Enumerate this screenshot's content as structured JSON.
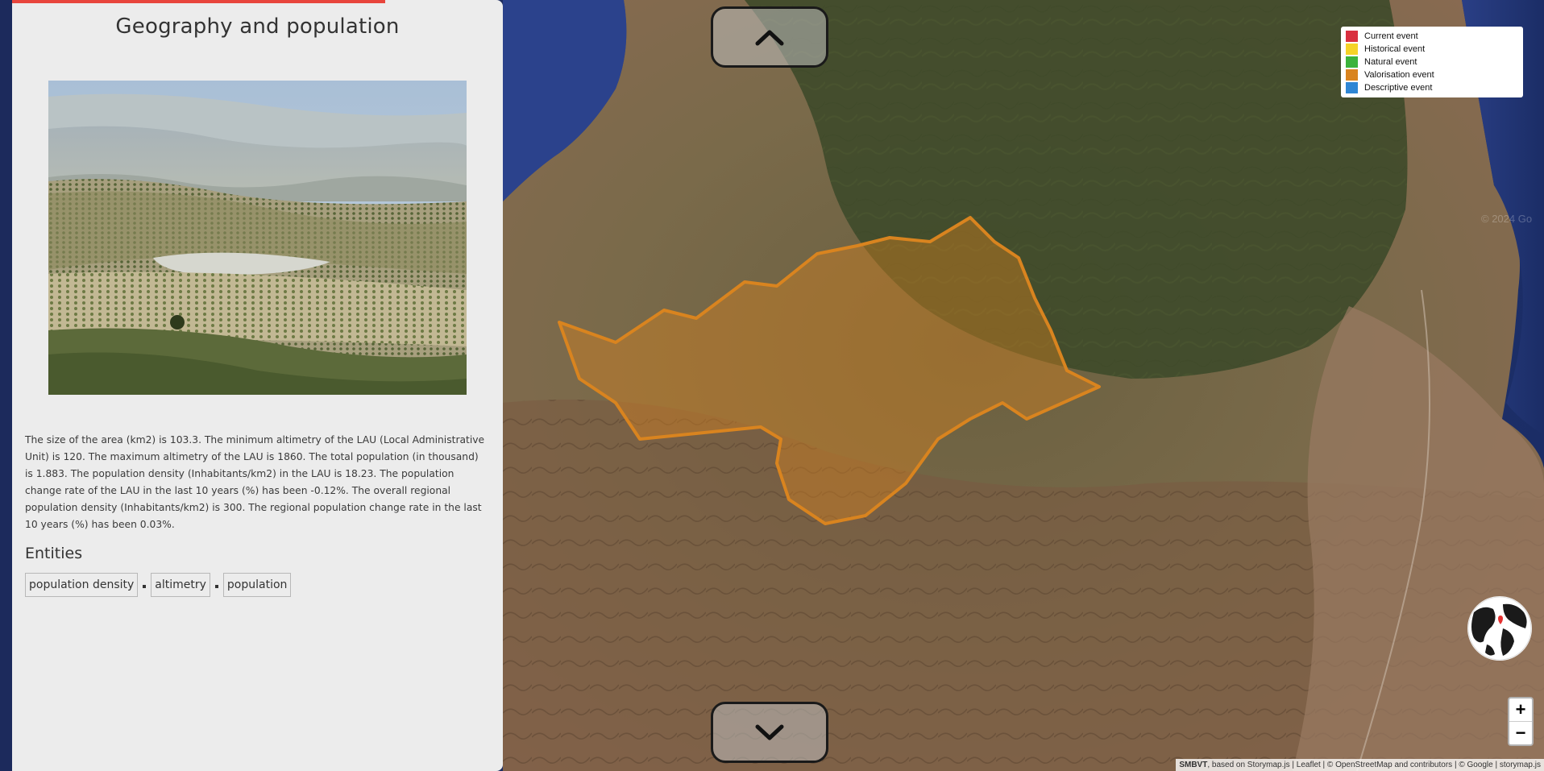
{
  "story": {
    "title": "Geography and population",
    "body": "The size of the area (km2) is 103.3. The minimum altimetry of the LAU (Local Administrative Unit) is 120. The maximum altimetry of the LAU is 1860. The total population (in thousand) is 1.883. The population density (Inhabitants/km2) in the LAU is 18.23. The population change rate of the LAU in the last 10 years (%) has been -0.12%. The overall regional population density (Inhabitants/km2) is 300. The regional population change rate in the last 10 years (%) has been 0.03%.",
    "entities_heading": "Entities",
    "entities": [
      "population density",
      "altimetry",
      "population"
    ],
    "progress_color": "#e8453c"
  },
  "map": {
    "legend": [
      {
        "label": "Current event",
        "color": "#d9303f"
      },
      {
        "label": "Historical event",
        "color": "#f5d327"
      },
      {
        "label": "Natural event",
        "color": "#3bb33b"
      },
      {
        "label": "Valorisation event",
        "color": "#d9841f"
      },
      {
        "label": "Descriptive event",
        "color": "#2f86d4"
      }
    ],
    "area_color": "#d9841f",
    "zoom_in": "+",
    "zoom_out": "−",
    "watermark": "© 2024 Go",
    "nav_up_icon": "chevron-up-icon",
    "nav_down_icon": "chevron-down-icon"
  },
  "attribution": {
    "brand": "SMBVT",
    "text": ", based on Storymap.js | Leaflet | © OpenStreetMap and contributors | © Google | ",
    "storymap": "storymap.js"
  }
}
